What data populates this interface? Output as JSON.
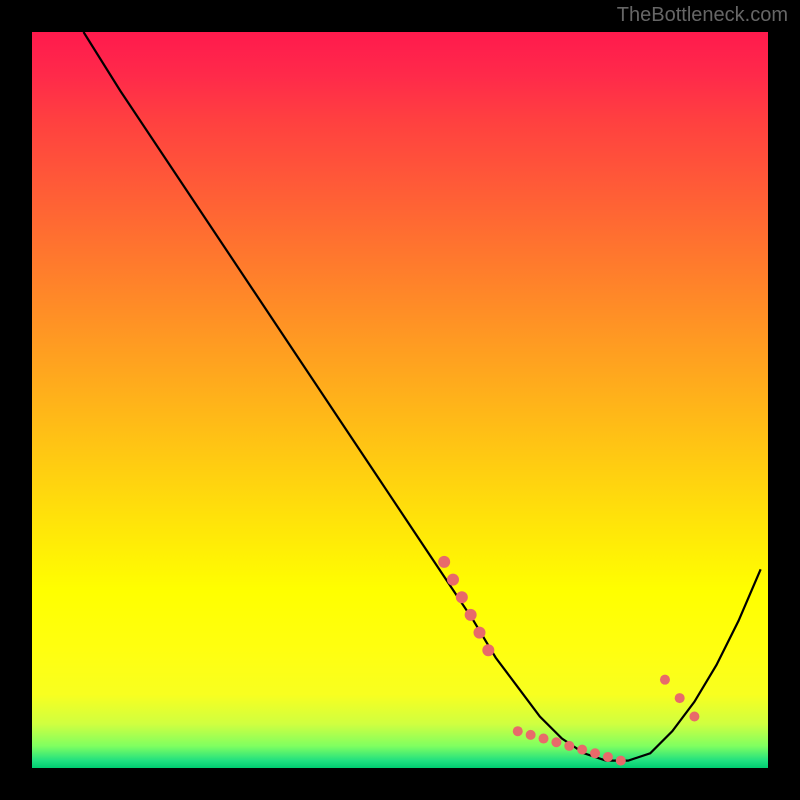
{
  "watermark": "TheBottleneck.com",
  "chart_data": {
    "type": "line",
    "title": "",
    "xlabel": "",
    "ylabel": "",
    "xlim": [
      0,
      100
    ],
    "ylim": [
      0,
      100
    ],
    "grid": false,
    "curve": {
      "name": "bottleneck-curve",
      "x": [
        7,
        12,
        18,
        24,
        30,
        36,
        42,
        48,
        52,
        56,
        60,
        63,
        66,
        69,
        72,
        75,
        78,
        81,
        84,
        87,
        90,
        93,
        96,
        99
      ],
      "y": [
        100,
        92,
        83,
        74,
        65,
        56,
        47,
        38,
        32,
        26,
        20,
        15,
        11,
        7,
        4,
        2,
        1,
        1,
        2,
        5,
        9,
        14,
        20,
        27
      ]
    },
    "left_dot_cluster": {
      "x_range": [
        56,
        62
      ],
      "y_range": [
        16,
        28
      ],
      "count": 6
    },
    "bottom_dot_cluster": {
      "x_range": [
        66,
        80
      ],
      "y_range": [
        1,
        5
      ],
      "count": 9
    },
    "right_dot_cluster": {
      "x_range": [
        86,
        90
      ],
      "y_range": [
        7,
        12
      ],
      "count": 3
    },
    "dot_color": "#e86a6a",
    "curve_color": "#000000",
    "gradient_stops": [
      {
        "pos": 0,
        "color": "#ff1a4d"
      },
      {
        "pos": 50,
        "color": "#ffb020"
      },
      {
        "pos": 80,
        "color": "#ffff00"
      },
      {
        "pos": 100,
        "color": "#00cc70"
      }
    ]
  }
}
